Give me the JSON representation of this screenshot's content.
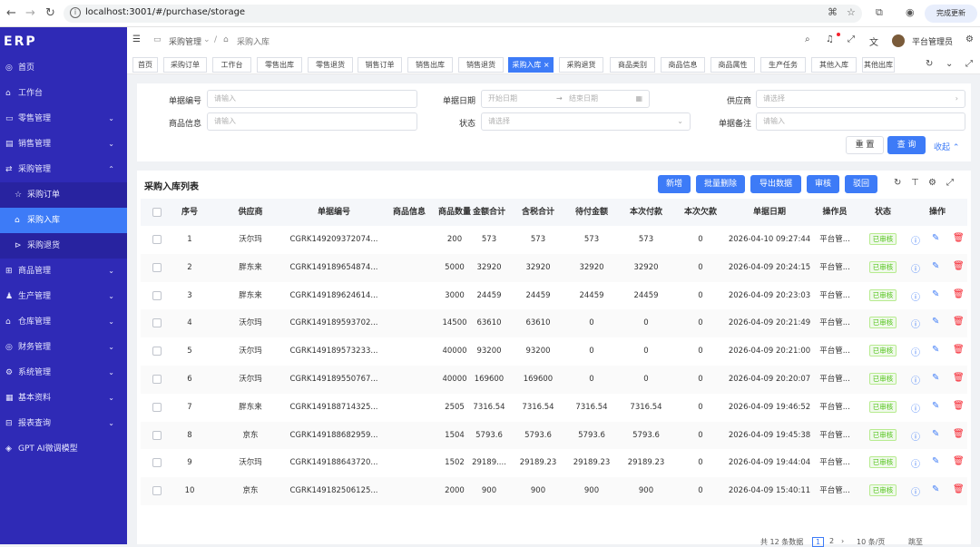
{
  "browser": {
    "url": "localhost:3001/#/purchase/storage",
    "update_label": "完成更新"
  },
  "sidebar": {
    "logo": "ERP",
    "items": [
      {
        "label": "首页",
        "icon": "◎",
        "arrow": ""
      },
      {
        "label": "工作台",
        "icon": "⌂",
        "arrow": ""
      },
      {
        "label": "零售管理",
        "icon": "▭",
        "arrow": "⌄"
      },
      {
        "label": "销售管理",
        "icon": "▤",
        "arrow": "⌄"
      },
      {
        "label": "采购管理",
        "icon": "⇄",
        "arrow": "⌃"
      },
      {
        "label": "采购订单",
        "icon": "☆",
        "arrow": ""
      },
      {
        "label": "采购入库",
        "icon": "⌂",
        "arrow": ""
      },
      {
        "label": "采购退货",
        "icon": "⊳",
        "arrow": ""
      },
      {
        "label": "商品管理",
        "icon": "⊞",
        "arrow": "⌄"
      },
      {
        "label": "生产管理",
        "icon": "♟",
        "arrow": "⌄"
      },
      {
        "label": "仓库管理",
        "icon": "⌂",
        "arrow": "⌄"
      },
      {
        "label": "财务管理",
        "icon": "◎",
        "arrow": "⌄"
      },
      {
        "label": "系统管理",
        "icon": "⚙",
        "arrow": "⌄"
      },
      {
        "label": "基本资料",
        "icon": "▦",
        "arrow": "⌄"
      },
      {
        "label": "报表查询",
        "icon": "⊟",
        "arrow": "⌄"
      },
      {
        "label": "GPT AI微调模型",
        "icon": "◈",
        "arrow": ""
      }
    ]
  },
  "topbar": {
    "crumb1": "采购管理",
    "crumb_sep": "/",
    "crumb2": "采购入库",
    "user": "平台管理员"
  },
  "tabs": [
    "首页",
    "采购订单",
    "工作台",
    "零售出库",
    "零售退货",
    "销售订单",
    "销售出库",
    "销售退货",
    "采购入库",
    "采购退货",
    "商品类别",
    "商品信息",
    "商品属性",
    "生产任务",
    "其他入库",
    "其他出库"
  ],
  "tab_close": "×",
  "filters": {
    "bill_no_label": "单据编号",
    "bill_no_placeholder": "请输入",
    "date_label": "单据日期",
    "date_start_placeholder": "开始日期",
    "date_arrow": "→",
    "date_end_placeholder": "结束日期",
    "supplier_label": "供应商",
    "supplier_placeholder": "请选择",
    "product_label": "商品信息",
    "product_placeholder": "请输入",
    "status_label": "状态",
    "status_placeholder": "请选择",
    "remark_label": "单据备注",
    "remark_placeholder": "请输入",
    "reset_label": "重 置",
    "search_label": "查 询",
    "collapse_label": "收起"
  },
  "table": {
    "title": "采购入库列表",
    "actions": [
      "新增",
      "批量删除",
      "导出数据",
      "审核",
      "驳回"
    ],
    "columns": [
      "序号",
      "供应商",
      "单据编号",
      "商品信息",
      "商品数量",
      "金额合计",
      "含税合计",
      "待付金额",
      "本次付款",
      "本次欠款",
      "单据日期",
      "操作员",
      "状态",
      "操作"
    ],
    "rows": [
      {
        "no": "1",
        "supplier": "沃尔玛",
        "bill": "CGRK149209372074...",
        "product": "",
        "qty": "200",
        "amount": "573",
        "tax": "573",
        "due": "573",
        "paid": "573",
        "debt": "0",
        "date": "2026-04-10 09:27:44",
        "operator": "平台管...",
        "status": "已审核"
      },
      {
        "no": "2",
        "supplier": "胖东来",
        "bill": "CGRK149189654874...",
        "product": "",
        "qty": "5000",
        "amount": "32920",
        "tax": "32920",
        "due": "32920",
        "paid": "32920",
        "debt": "0",
        "date": "2026-04-09 20:24:15",
        "operator": "平台管...",
        "status": "已审核"
      },
      {
        "no": "3",
        "supplier": "胖东来",
        "bill": "CGRK149189624614...",
        "product": "",
        "qty": "3000",
        "amount": "24459",
        "tax": "24459",
        "due": "24459",
        "paid": "24459",
        "debt": "0",
        "date": "2026-04-09 20:23:03",
        "operator": "平台管...",
        "status": "已审核"
      },
      {
        "no": "4",
        "supplier": "沃尔玛",
        "bill": "CGRK149189593702...",
        "product": "",
        "qty": "14500",
        "amount": "63610",
        "tax": "63610",
        "due": "0",
        "paid": "0",
        "debt": "0",
        "date": "2026-04-09 20:21:49",
        "operator": "平台管...",
        "status": "已审核"
      },
      {
        "no": "5",
        "supplier": "沃尔玛",
        "bill": "CGRK149189573233...",
        "product": "",
        "qty": "40000",
        "amount": "93200",
        "tax": "93200",
        "due": "0",
        "paid": "0",
        "debt": "0",
        "date": "2026-04-09 20:21:00",
        "operator": "平台管...",
        "status": "已审核"
      },
      {
        "no": "6",
        "supplier": "沃尔玛",
        "bill": "CGRK149189550767...",
        "product": "",
        "qty": "40000",
        "amount": "169600",
        "tax": "169600",
        "due": "0",
        "paid": "0",
        "debt": "0",
        "date": "2026-04-09 20:20:07",
        "operator": "平台管...",
        "status": "已审核"
      },
      {
        "no": "7",
        "supplier": "胖东来",
        "bill": "CGRK149188714325...",
        "product": "",
        "qty": "2505",
        "amount": "7316.54",
        "tax": "7316.54",
        "due": "7316.54",
        "paid": "7316.54",
        "debt": "0",
        "date": "2026-04-09 19:46:52",
        "operator": "平台管...",
        "status": "已审核"
      },
      {
        "no": "8",
        "supplier": "京东",
        "bill": "CGRK149188682959...",
        "product": "",
        "qty": "1504",
        "amount": "5793.6",
        "tax": "5793.6",
        "due": "5793.6",
        "paid": "5793.6",
        "debt": "0",
        "date": "2026-04-09 19:45:38",
        "operator": "平台管...",
        "status": "已审核"
      },
      {
        "no": "9",
        "supplier": "沃尔玛",
        "bill": "CGRK149188643720...",
        "product": "",
        "qty": "1502",
        "amount": "29189....",
        "tax": "29189.23",
        "due": "29189.23",
        "paid": "29189.23",
        "debt": "0",
        "date": "2026-04-09 19:44:04",
        "operator": "平台管...",
        "status": "已审核"
      },
      {
        "no": "10",
        "supplier": "京东",
        "bill": "CGRK149182506125...",
        "product": "",
        "qty": "2000",
        "amount": "900",
        "tax": "900",
        "due": "900",
        "paid": "900",
        "debt": "0",
        "date": "2026-04-09 15:40:11",
        "operator": "平台管...",
        "status": "已审核"
      }
    ]
  },
  "pager": {
    "total": "共 12 条数据",
    "page1": "1",
    "page2": "2",
    "size": "10 条/页",
    "goto": "跳至"
  },
  "colors": {
    "sidebar": "#2f2ab6",
    "accent": "#3d7bf7",
    "status_green": "#52c41a"
  }
}
